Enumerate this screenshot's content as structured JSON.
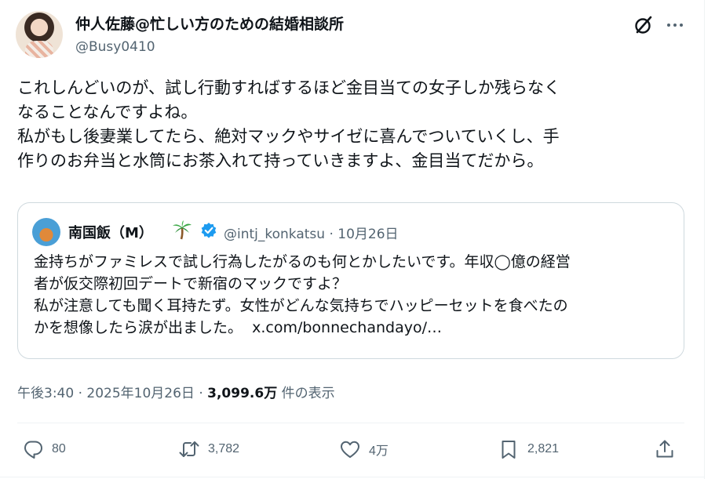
{
  "author": {
    "name": "仲人佐藤@忙しい方のための結婚相談所",
    "handle": "@Busy0410"
  },
  "tweet": {
    "lines": [
      "これしんどいのが、試し行動すればするほど金目当ての女子しか残らなく",
      "なることなんですよね。",
      "私がもし後妻業してたら、絶対マックやサイゼに喜んでついていくし、手",
      "作りのお弁当と水筒にお茶入れて持っていきますよ、金目当てだから。"
    ]
  },
  "quote": {
    "name": "南国飯（M）",
    "handle_date": "@intj_konkatsu · 10月26日",
    "lines": [
      "金持ちがファミレスで試し行為したがるのも何とかしたいです。年収◯億の経営",
      "者が仮交際初回デートで新宿のマックですよ？",
      "私が注意しても聞く耳持たず。女性がどんな気持ちでハッピーセットを食べたの"
    ],
    "last_line": "かを想像したら涙が出ました。",
    "link": "x.com/bonnechandayo/…"
  },
  "meta": {
    "time_date": "午後3:40 · 2025年10月26日 · ",
    "views": "3,099.6万",
    "views_suffix": " 件の表示"
  },
  "actions": {
    "reply": "80",
    "retweet": "3,782",
    "like": "4万",
    "bookmark": "2,821"
  },
  "colors": {
    "text": "#0f1419",
    "secondary": "#536471",
    "border": "#cfd9de",
    "verified": "#1d9bf0"
  },
  "icons": [
    "grok-icon",
    "more-icon",
    "palm-tree-icon",
    "verified-badge-icon",
    "reply-icon",
    "retweet-icon",
    "like-icon",
    "bookmark-icon",
    "share-icon"
  ]
}
